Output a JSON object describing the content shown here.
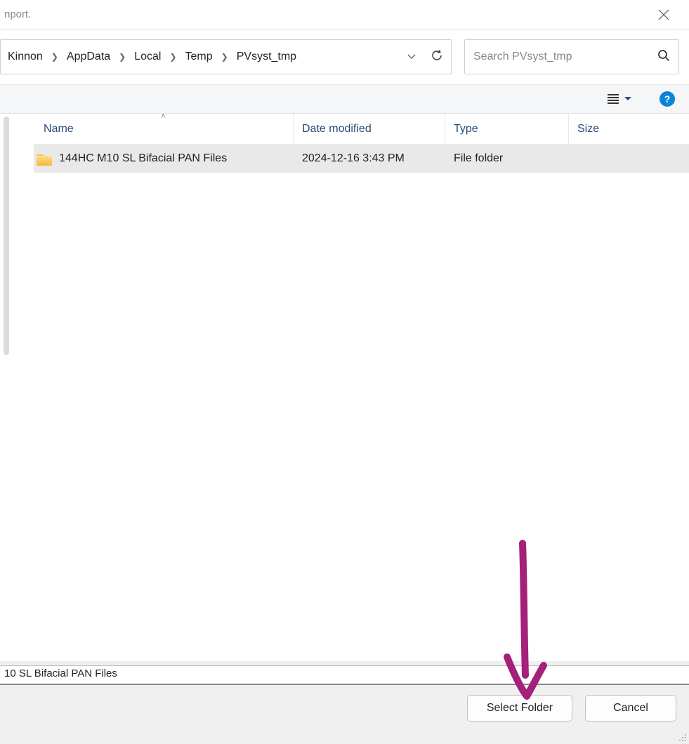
{
  "titlebar": {
    "fragment": "nport."
  },
  "breadcrumbs": [
    "Kinnon",
    "AppData",
    "Local",
    "Temp",
    "PVsyst_tmp"
  ],
  "search": {
    "placeholder": "Search PVsyst_tmp"
  },
  "columns": {
    "name": "Name",
    "date": "Date modified",
    "type": "Type",
    "size": "Size"
  },
  "rows": [
    {
      "name": "144HC M10 SL Bifacial PAN Files",
      "date": "2024-12-16 3:43 PM",
      "type": "File folder",
      "size": ""
    }
  ],
  "filename": {
    "value": "10 SL Bifacial PAN Files"
  },
  "buttons": {
    "select": "Select Folder",
    "cancel": "Cancel"
  },
  "help_label": "?"
}
